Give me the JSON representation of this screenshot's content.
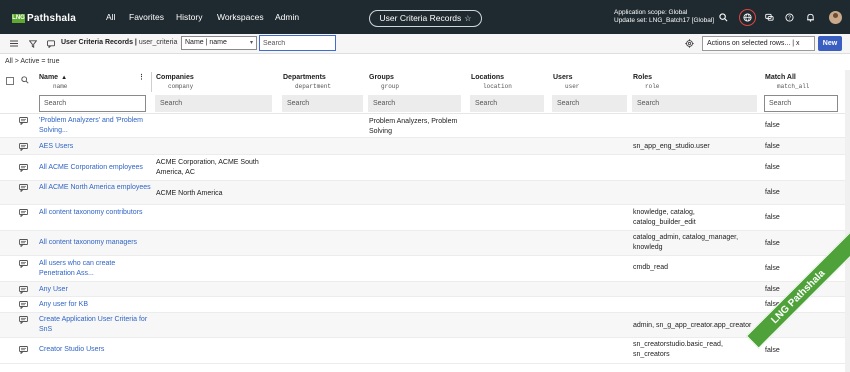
{
  "topbar": {
    "logo_mark": "LNG",
    "logo_text": "Pathshala",
    "nav": [
      "All",
      "Favorites",
      "History",
      "Workspaces",
      "Admin"
    ],
    "record_pill": "User Criteria Records",
    "scope_line1": "Application scope: Global",
    "scope_line2": "Update set: LNG_Batch17 [Global]"
  },
  "toolbar": {
    "list_title": "User Criteria Records",
    "list_table": "user_criteria",
    "search_field": "Name | name",
    "search_placeholder": "Search",
    "actions_label": "Actions on selected rows... | x",
    "new_label": "New"
  },
  "breadcrumb": "All > Active = true",
  "columns": [
    {
      "label": "Name",
      "sub": "name"
    },
    {
      "label": "Companies",
      "sub": "company"
    },
    {
      "label": "Departments",
      "sub": "department"
    },
    {
      "label": "Groups",
      "sub": "group"
    },
    {
      "label": "Locations",
      "sub": "location"
    },
    {
      "label": "Users",
      "sub": "user"
    },
    {
      "label": "Roles",
      "sub": "role"
    },
    {
      "label": "Match All",
      "sub": "match_all"
    }
  ],
  "filter_placeholder": "Search",
  "rows": [
    {
      "name": "'Problem Analyzers' and 'Problem Solving...",
      "companies": "",
      "groups": "Problem Analyzers, Problem Solving",
      "roles": "",
      "match": "false"
    },
    {
      "name": "AES Users",
      "companies": "",
      "groups": "",
      "roles": "sn_app_eng_studio.user",
      "match": "false"
    },
    {
      "name": "All ACME Corporation employees",
      "companies": "ACME Corporation, ACME South America, AC",
      "groups": "",
      "roles": "",
      "match": "false"
    },
    {
      "name": "All ACME North America employees",
      "companies": "ACME North America",
      "groups": "",
      "roles": "",
      "match": "false"
    },
    {
      "name": "All content taxonomy contributors",
      "companies": "",
      "groups": "",
      "roles": "knowledge, catalog, catalog_builder_edit",
      "match": "false"
    },
    {
      "name": "All content taxonomy managers",
      "companies": "",
      "groups": "",
      "roles": "catalog_admin, catalog_manager, knowledg",
      "match": "false"
    },
    {
      "name": "All users who can create Penetration Ass...",
      "companies": "",
      "groups": "",
      "roles": "cmdb_read",
      "match": "false"
    },
    {
      "name": "Any User",
      "companies": "",
      "groups": "",
      "roles": "",
      "match": "false"
    },
    {
      "name": "Any user for KB",
      "companies": "",
      "groups": "",
      "roles": "",
      "match": "false"
    },
    {
      "name": "Create Application User Criteria for SnS",
      "companies": "",
      "groups": "",
      "roles": "admin, sn_g_app_creator.app_creator",
      "match": "false"
    },
    {
      "name": "Creator Studio Users",
      "companies": "",
      "groups": "",
      "roles": "sn_creatorstudio.basic_read, sn_creators",
      "match": "false"
    }
  ],
  "watermark": "LNG Pathshala"
}
